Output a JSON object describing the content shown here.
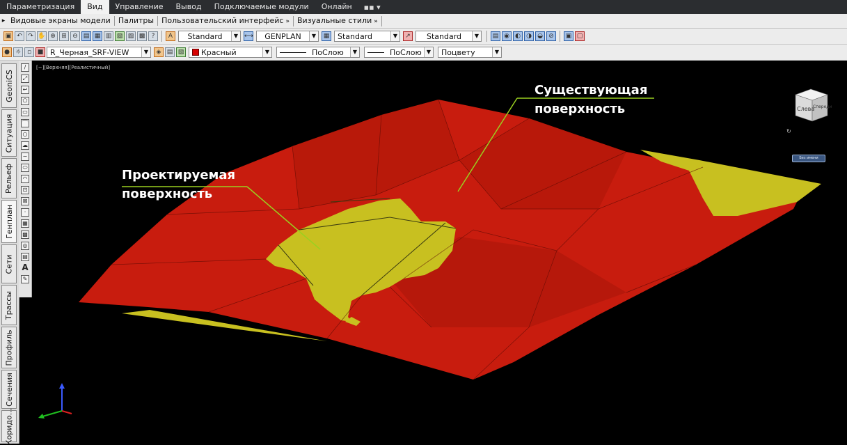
{
  "ribbon": {
    "tabs": [
      {
        "label": "Параметризация"
      },
      {
        "label": "Вид"
      },
      {
        "label": "Управление"
      },
      {
        "label": "Вывод"
      },
      {
        "label": "Подключаемые модули"
      },
      {
        "label": "Онлайн"
      }
    ],
    "extra": "▪▪ ▾",
    "active_tab": "Вид"
  },
  "panels": {
    "items": [
      {
        "label": "Видовые экраны модели"
      },
      {
        "label": "Палитры"
      },
      {
        "label": "Пользовательский интерфейс"
      },
      {
        "label": "Визуальные стили"
      }
    ],
    "close_glyph": "»"
  },
  "toolbar1": {
    "text_style": "Standard",
    "dim_style": "GENPLAN",
    "table_style": "Standard",
    "mleader_style": "Standard"
  },
  "toolbar2": {
    "layer": "R_Черная_SRF-VIEW",
    "color": "Красный",
    "linetype": "ПоСлою",
    "lineweight": "ПоСлою",
    "plotstyle": "Поцвету"
  },
  "left_tabs": [
    {
      "label": "GeoniCS"
    },
    {
      "label": "Ситуация"
    },
    {
      "label": "Рельеф"
    },
    {
      "label": "Генплан"
    },
    {
      "label": "Сети"
    },
    {
      "label": "Трассы"
    },
    {
      "label": "Профиль"
    },
    {
      "label": "Сечения"
    },
    {
      "label": "Коридо..."
    }
  ],
  "viewport": {
    "label": "[−][Верхняя][Реалистичный]",
    "annotation_existing": [
      "Существующая",
      "поверхность"
    ],
    "annotation_designed": [
      "Проектируемая",
      "поверхность"
    ],
    "viewcube_left": "Слева",
    "viewcube_front": "Спереди",
    "wcs_label": "Без имени"
  },
  "colors": {
    "existing_surface": "#c81c0e",
    "designed_surface": "#c8c020",
    "leader": "#9ad020",
    "background": "#000000"
  },
  "icons": {
    "toolbar1": [
      "workspace-icon",
      "undo-icon",
      "redo-icon",
      "pan-icon",
      "zoom-realtime-icon",
      "zoom-window-icon",
      "zoom-previous-icon",
      "properties-icon",
      "sheet-set-icon",
      "design-center-icon",
      "tool-palettes-icon",
      "markup-icon",
      "calculator-icon",
      "help-icon",
      "text-style-icon",
      "dim-style-icon",
      "table-style-icon",
      "mleader-style-icon"
    ],
    "toolbar2": [
      "layer-state-icon",
      "layer-make-current-icon",
      "layer-previous-icon"
    ],
    "draw_tools": [
      "line-icon",
      "polyline-icon",
      "arc-icon",
      "polygon-icon",
      "rectangle-icon",
      "arc2-icon",
      "circle-icon",
      "revcloud-icon",
      "spline-icon",
      "ellipse-icon",
      "ellipse-arc-icon",
      "insert-block-icon",
      "make-block-icon",
      "point-icon",
      "hatch-icon",
      "gradient-icon",
      "region-icon",
      "table-icon",
      "mtext-icon",
      "add-selected-icon"
    ]
  }
}
